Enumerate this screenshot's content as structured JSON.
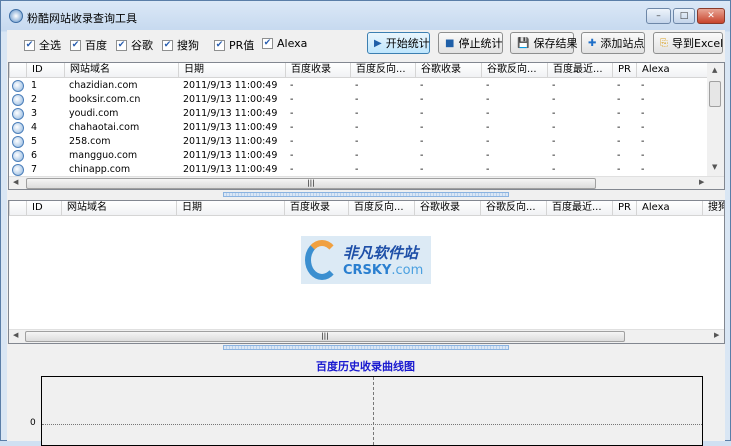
{
  "window": {
    "title": "粉酷网站收录查询工具",
    "min": "–",
    "max": "□",
    "close": "✕"
  },
  "filters": [
    {
      "label": "全选",
      "checked": true
    },
    {
      "label": "百度",
      "checked": true
    },
    {
      "label": "谷歌",
      "checked": true
    },
    {
      "label": "搜狗",
      "checked": true
    },
    {
      "label": "PR值",
      "checked": true
    },
    {
      "label": "Alexa",
      "checked": true
    }
  ],
  "toolbar": [
    {
      "label": "开始统计",
      "icon": "play-icon",
      "glyph": "▶",
      "color": "#1f5fa8"
    },
    {
      "label": "停止统计",
      "icon": "stop-icon",
      "glyph": "■",
      "color": "#1f5fa8"
    },
    {
      "label": "保存结果",
      "icon": "save-icon",
      "glyph": "💾",
      "color": "#1f5fa8"
    },
    {
      "label": "添加站点",
      "icon": "add-icon",
      "glyph": "✚",
      "color": "#1f6fc8"
    },
    {
      "label": "导到Excel",
      "icon": "export-icon",
      "glyph": "⎘",
      "color": "#d9a020"
    }
  ],
  "grid1": {
    "columns": [
      "",
      "ID",
      "网站域名",
      "日期",
      "百度收录",
      "百度反向...",
      "谷歌收录",
      "谷歌反向...",
      "百度最近...",
      "PR",
      "Alexa"
    ],
    "rows": [
      [
        "1",
        "chazidian.com",
        "2011/9/13 11:00:49",
        "-",
        "-",
        "-",
        "-",
        "-",
        "-",
        "-"
      ],
      [
        "2",
        "booksir.com.cn",
        "2011/9/13 11:00:49",
        "-",
        "-",
        "-",
        "-",
        "-",
        "-",
        "-"
      ],
      [
        "3",
        "youdi.com",
        "2011/9/13 11:00:49",
        "-",
        "-",
        "-",
        "-",
        "-",
        "-",
        "-"
      ],
      [
        "4",
        "chahaotai.com",
        "2011/9/13 11:00:49",
        "-",
        "-",
        "-",
        "-",
        "-",
        "-",
        "-"
      ],
      [
        "5",
        "258.com",
        "2011/9/13 11:00:49",
        "-",
        "-",
        "-",
        "-",
        "-",
        "-",
        "-"
      ],
      [
        "6",
        "mangguo.com",
        "2011/9/13 11:00:49",
        "-",
        "-",
        "-",
        "-",
        "-",
        "-",
        "-"
      ],
      [
        "7",
        "chinapp.com",
        "2011/9/13 11:00:49",
        "-",
        "-",
        "-",
        "-",
        "-",
        "-",
        "-"
      ]
    ]
  },
  "grid2": {
    "columns": [
      "",
      "ID",
      "网站域名",
      "日期",
      "百度收录",
      "百度反向...",
      "谷歌收录",
      "谷歌反向...",
      "百度最近...",
      "PR",
      "Alexa",
      "搜狗"
    ]
  },
  "watermark": {
    "cn": "非凡软件站",
    "en": "CRSKY",
    "tld": ".com"
  },
  "chart_data": {
    "type": "line",
    "title": "百度历史收录曲线图",
    "series": [],
    "yticks": [
      "0"
    ],
    "grid": true
  }
}
